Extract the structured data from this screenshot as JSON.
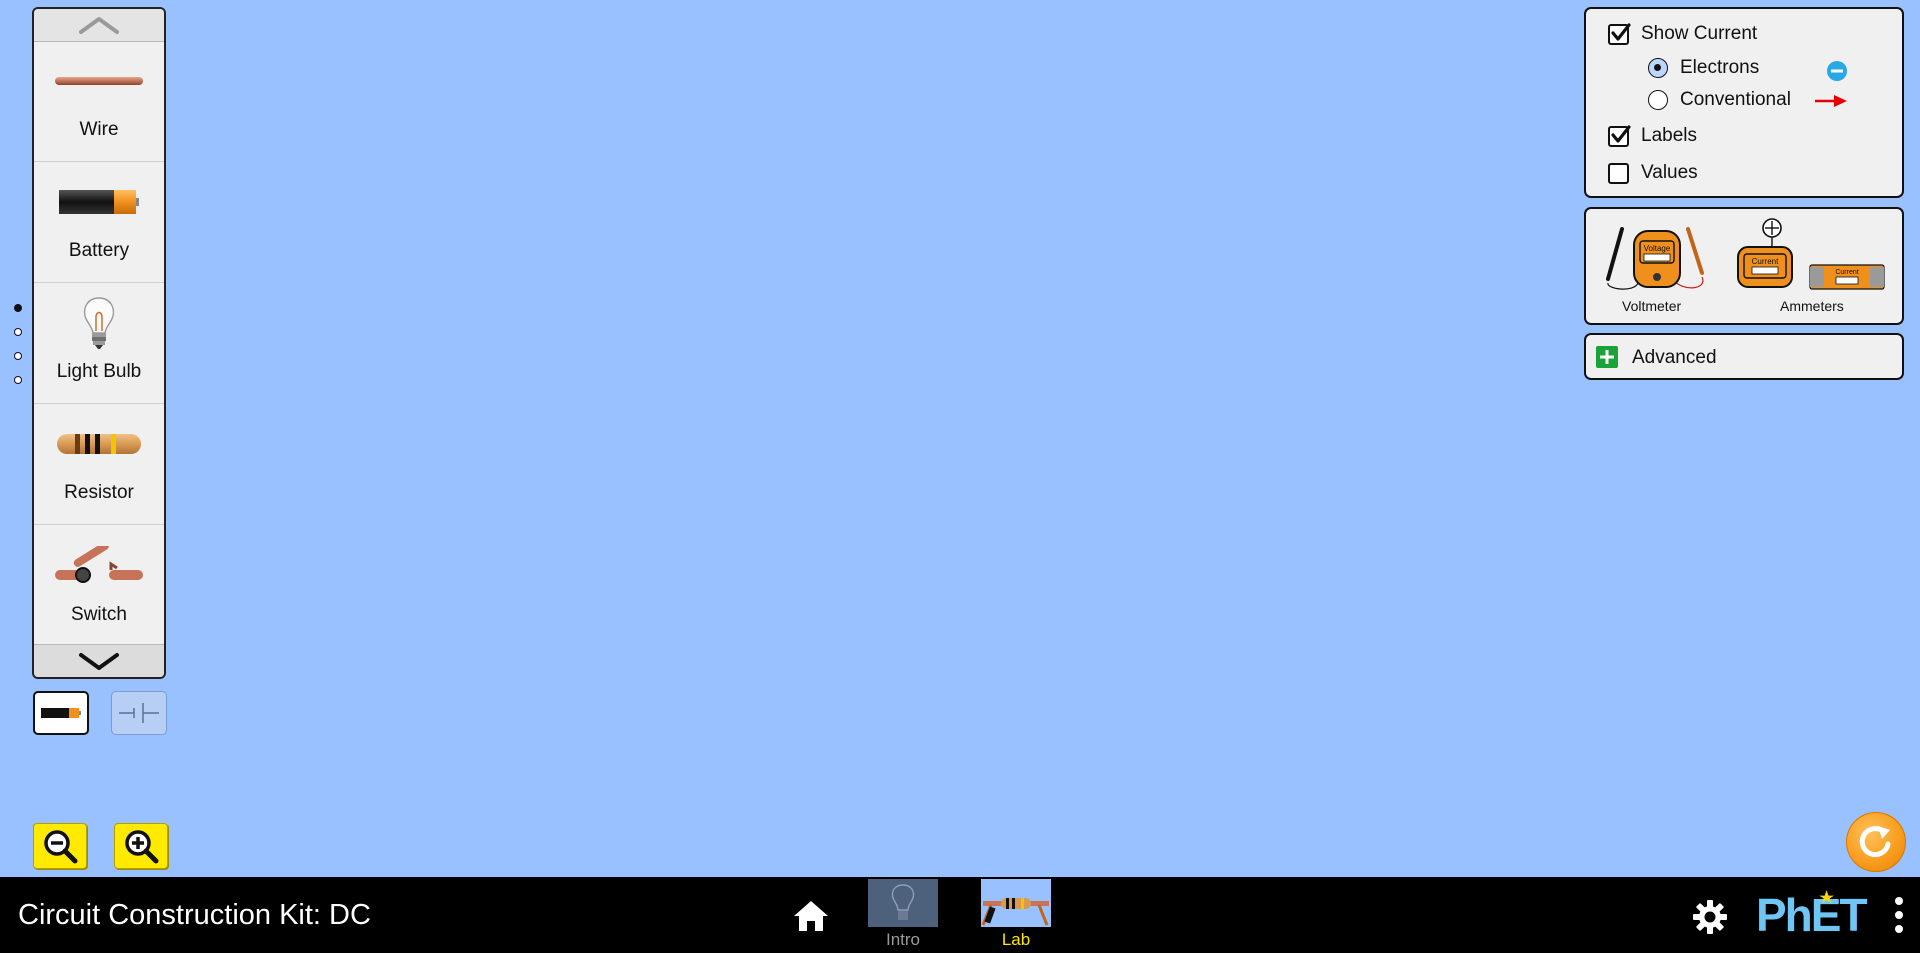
{
  "carousel": {
    "items": [
      {
        "label": "Wire"
      },
      {
        "label": "Battery"
      },
      {
        "label": "Light Bulb"
      },
      {
        "label": "Resistor"
      },
      {
        "label": "Switch"
      }
    ],
    "page_count": 4,
    "current_page": 1
  },
  "display": {
    "show_current": {
      "label": "Show Current",
      "checked": true
    },
    "electrons": {
      "label": "Electrons",
      "selected": true
    },
    "conventional": {
      "label": "Conventional",
      "selected": false
    },
    "labels": {
      "label": "Labels",
      "checked": true
    },
    "values": {
      "label": "Values",
      "checked": false
    }
  },
  "sensors": {
    "voltmeter": {
      "label": "Voltmeter",
      "screen_text": "Voltage"
    },
    "ammeters": {
      "label": "Ammeters",
      "screen_text": "Current"
    }
  },
  "advanced": {
    "label": "Advanced"
  },
  "navbar": {
    "title": "Circuit Construction Kit: DC",
    "tabs": [
      {
        "label": "Intro",
        "selected": false
      },
      {
        "label": "Lab",
        "selected": true
      }
    ]
  },
  "colors": {
    "background": "#99c0ff",
    "zoom": "#ffea00",
    "reset": "#f79a1a",
    "selected_tab": "#ffe600",
    "electron": "#29a8e8",
    "conventional_arrow": "#e60000",
    "advanced_plus": "#1aa33a"
  },
  "icons": [
    "chevron-up-icon",
    "chevron-down-icon",
    "wire-icon",
    "battery-icon",
    "light-bulb-icon",
    "resistor-icon",
    "switch-icon",
    "zoom-out-icon",
    "zoom-in-icon",
    "home-icon",
    "gear-icon",
    "reset-icon",
    "phet-logo",
    "kebab-menu-icon"
  ]
}
